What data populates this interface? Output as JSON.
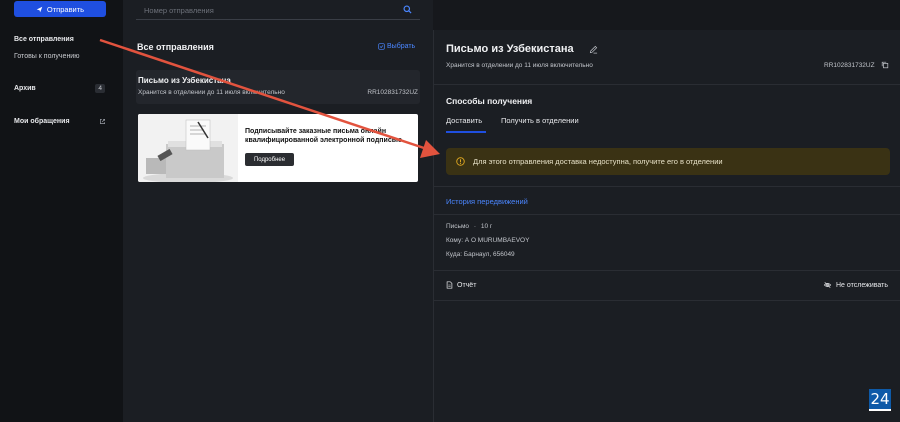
{
  "sidebar": {
    "send_label": "Отправить",
    "items": [
      {
        "label": "Все отправления"
      },
      {
        "label": "Готовы к получению"
      },
      {
        "label": "Архив",
        "badge": "4"
      },
      {
        "label": "Мои обращения"
      }
    ]
  },
  "search": {
    "placeholder": "Номер отправления"
  },
  "list": {
    "title": "Все отправления",
    "select_label": "Выбрать",
    "card": {
      "title": "Письмо из Узбекистана",
      "subtitle": "Хранится в отделении до 11 июля включительно",
      "track": "RR102831732UZ"
    },
    "banner": {
      "text": "Подписывайте заказные письма онлайн квалифицированной электронной подписью",
      "button": "Подробнее"
    }
  },
  "details": {
    "title": "Письмо из Узбекистана",
    "subtitle": "Хранится в отделении до 11 июля включительно",
    "track": "RR102831732UZ",
    "methods_title": "Способы получения",
    "tabs": [
      "Доставить",
      "Получить в отделении"
    ],
    "warning": "Для этого отправления доставка недоступна, получите его в отделении",
    "history_link": "История передвижений",
    "type": "Письмо",
    "weight": "10 г",
    "to": "Кому: А О MURUMBAEVOY",
    "where": "Куда: Барнаул, 656049",
    "report_label": "Отчёт",
    "untrack_label": "Не отслеживать"
  },
  "watermark": "24",
  "colors": {
    "accent": "#1f4fe0",
    "link": "#4a86ff",
    "warning_bg": "#3a3214",
    "warning_icon": "#e0a820",
    "arrow": "#e2533e"
  }
}
